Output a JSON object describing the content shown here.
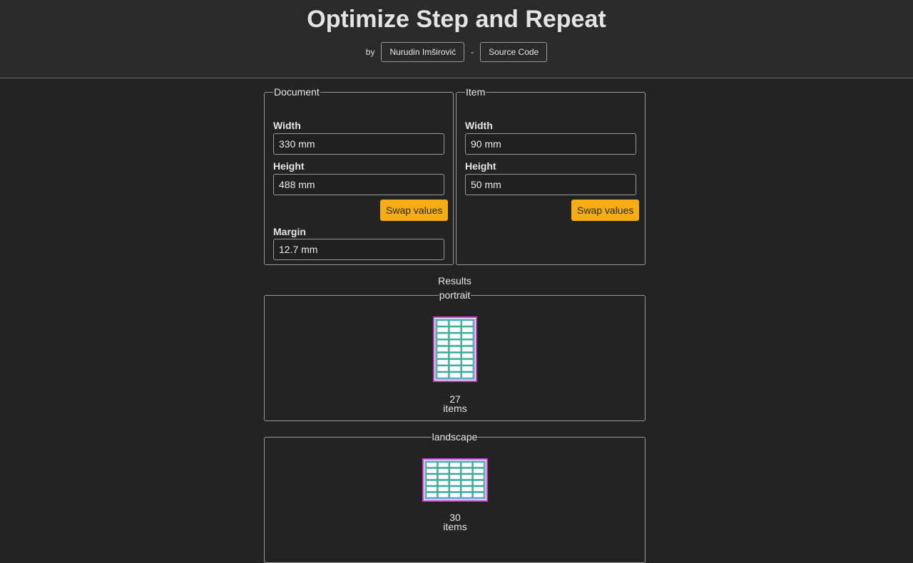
{
  "header": {
    "title": "Optimize Step and Repeat",
    "by_label": "by",
    "author_button": "Nurudin Imširović",
    "separator": "-",
    "source_button": "Source Code"
  },
  "document": {
    "legend": "Document",
    "width_label": "Width",
    "width_value": "330 mm",
    "height_label": "Height",
    "height_value": "488 mm",
    "swap_label": "Swap values",
    "margin_label": "Margin",
    "margin_value": "12.7 mm"
  },
  "item": {
    "legend": "Item",
    "width_label": "Width",
    "width_value": "90 mm",
    "height_label": "Height",
    "height_value": "50 mm",
    "swap_label": "Swap values"
  },
  "results": {
    "title": "Results",
    "portrait": {
      "legend": "portrait",
      "count": "27",
      "unit": "items",
      "cols": 3,
      "rows": 9
    },
    "landscape": {
      "legend": "landscape",
      "count": "30",
      "unit": "items",
      "cols": 5,
      "rows": 6
    }
  },
  "colors": {
    "accent": "#f5ad13",
    "sheet_border": "#c23fd6",
    "margin_border": "#3a56d8",
    "item_fill": "#3aaa9a",
    "sheet_fill": "#ffffff"
  }
}
